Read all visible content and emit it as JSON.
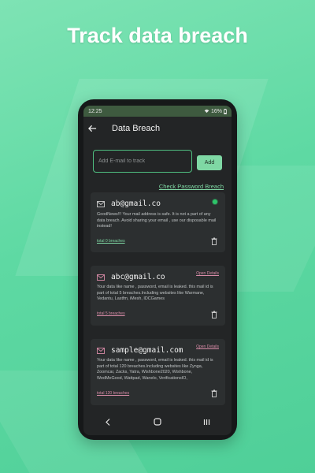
{
  "headline": "Track data breach",
  "status_bar": {
    "time": "12:25",
    "battery": "16%"
  },
  "app_bar": {
    "title": "Data Breach",
    "back_icon": "arrow-back-icon"
  },
  "email_input": {
    "placeholder": "Add E-mail to track",
    "value": ""
  },
  "add_button_label": "Add",
  "check_password_link": "Check Password Breach",
  "cards": [
    {
      "email": "ab@gmail.co",
      "message": "GoodNews!!! Your mail address is safe. It is not a part of any data breach. Avoid sharing your email , use our disposable mail instead!",
      "total": "total 0 breaches",
      "status": "safe",
      "icon": "mail-icon"
    },
    {
      "email": "abc@gmail.co",
      "open_details": "Open Details",
      "message": "Your data like name , password, email is leaked. this mail id is part of total 5 breaches.Including websites like Warmane, Vedantu, Lastfm, iMesh, IDCGames",
      "total": "total 5 breaches",
      "status": "breached",
      "icon": "mail-icon"
    },
    {
      "email": "sample@gmail.com",
      "open_details": "Open Details",
      "message": "Your data like name , password, email is leaked. this mail id is part of total 120 breaches.Including websites like Zynga, Zoomcar, Zacks, Yatra, Wishbone2020, Wishbone, WedMeGood, Wattpad, Wanelo, VerificationsIO,",
      "total": "total 120 breaches",
      "status": "breached",
      "icon": "mail-icon"
    }
  ],
  "colors": {
    "accent": "#7fd8a4",
    "safe_dot": "#2ec56a",
    "breach_pink": "#d68aa6",
    "card_bg": "#2c2f30"
  },
  "nav_icons": [
    "back-nav-icon",
    "home-nav-icon",
    "recents-nav-icon"
  ]
}
